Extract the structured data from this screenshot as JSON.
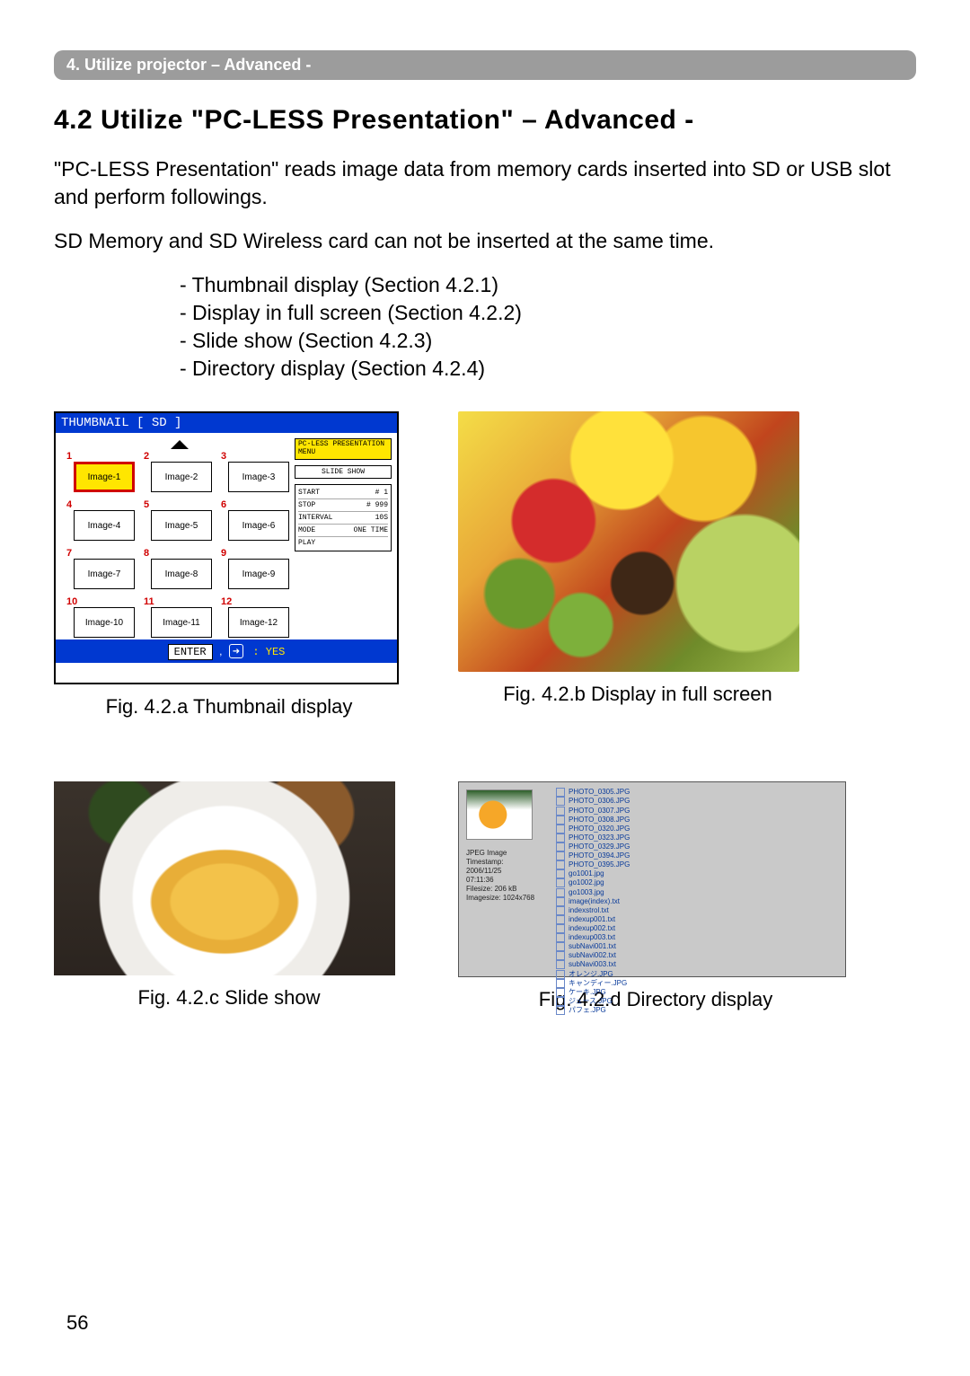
{
  "breadcrumb": "4.  Utilize projector – Advanced -",
  "heading": "4.2 Utilize \"PC-LESS Presentation\" – Advanced -",
  "intro_line1": "\"PC-LESS Presentation\" reads image data from memory cards inserted into SD or USB slot and perform followings.",
  "intro_line2": "SD Memory and SD Wireless card can not be inserted at the same time.",
  "bullets": [
    "- Thumbnail display (Section 4.2.1)",
    "- Display in full screen (Section 4.2.2)",
    "- Slide show (Section 4.2.3)",
    "- Directory display (Section 4.2.4)"
  ],
  "fig_a": {
    "caption": "Fig. 4.2.a Thumbnail display",
    "title": "THUMBNAIL [ SD ]",
    "menu_header": "PC-LESS PRESENTATION MENU",
    "side_label": "SLIDE SHOW",
    "side_items": [
      {
        "k": "START",
        "v": "# 1"
      },
      {
        "k": "STOP",
        "v": "# 999"
      },
      {
        "k": "INTERVAL",
        "v": "10S"
      },
      {
        "k": "MODE",
        "v": "ONE TIME"
      },
      {
        "k": "PLAY",
        "v": ""
      }
    ],
    "cells": [
      "Image-1",
      "Image-2",
      "Image-3",
      "Image-4",
      "Image-5",
      "Image-6",
      "Image-7",
      "Image-8",
      "Image-9",
      "Image-10",
      "Image-11",
      "Image-12"
    ],
    "nums": [
      "1",
      "2",
      "3",
      "4",
      "5",
      "6",
      "7",
      "8",
      "9",
      "10",
      "11",
      "12"
    ],
    "footer_enter": "ENTER",
    "footer_yes": ": YES"
  },
  "fig_b_caption": "Fig. 4.2.b Display in full screen",
  "fig_c_caption": "Fig. 4.2.c Slide show",
  "fig_d": {
    "caption": "Fig. 4.2.d Directory display",
    "meta": [
      "JPEG Image",
      "Timestamp:",
      "2006/11/25",
      "07:11:36",
      "Filesize: 206 kB",
      "Imagesize: 1024x768"
    ],
    "files": [
      "PHOTO_0305.JPG",
      "PHOTO_0306.JPG",
      "PHOTO_0307.JPG",
      "PHOTO_0308.JPG",
      "PHOTO_0320.JPG",
      "PHOTO_0323.JPG",
      "PHOTO_0329.JPG",
      "PHOTO_0394.JPG",
      "PHOTO_0395.JPG",
      "go1001.jpg",
      "go1002.jpg",
      "go1003.jpg",
      "image(index).txt",
      "indexstrol.txt",
      "indexup001.txt",
      "indexup002.txt",
      "indexup003.txt",
      "subNavi001.txt",
      "subNavi002.txt",
      "subNavi003.txt",
      "オレンジ.JPG",
      "キャンディー.JPG",
      "ケーキ.JPG",
      "ジュース.JPG",
      "パフェ.JPG"
    ]
  },
  "page_number": "56"
}
